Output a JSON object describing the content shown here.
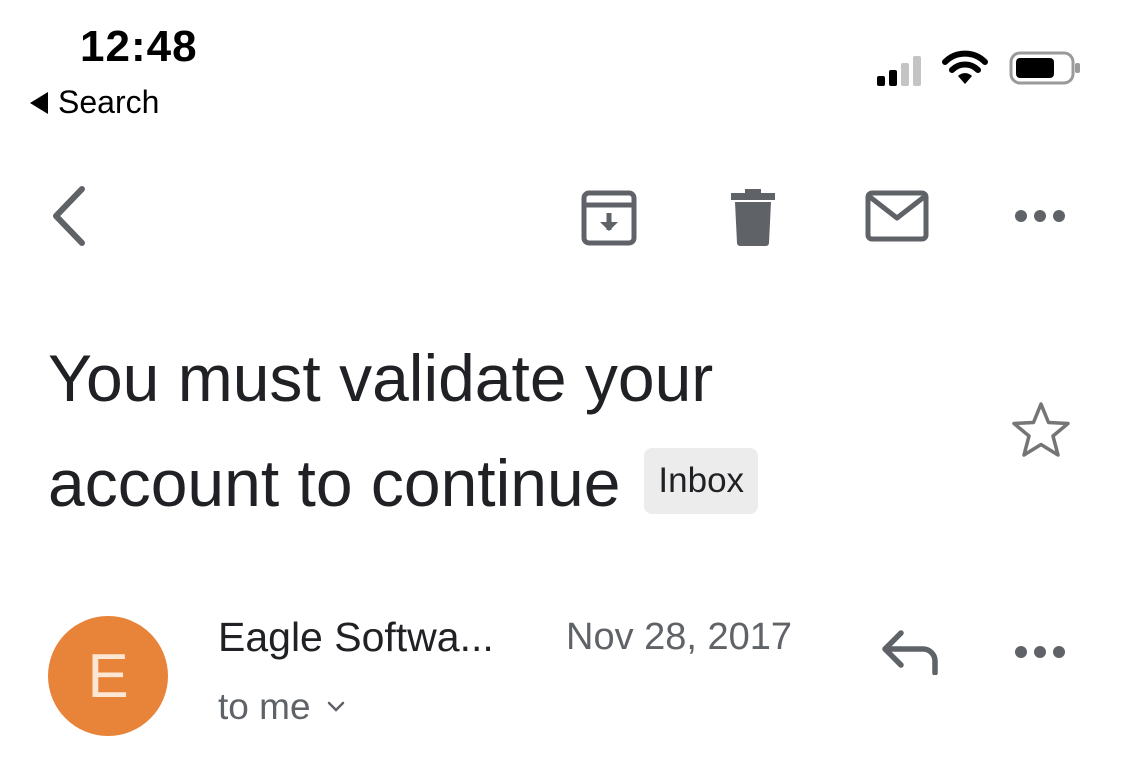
{
  "status_bar": {
    "time": "12:48",
    "back_app_label": "Search",
    "icons": [
      "cellular-signal-icon",
      "wifi-icon",
      "battery-icon"
    ]
  },
  "toolbar": {
    "icons": [
      "back-arrow-icon",
      "archive-icon",
      "trash-icon",
      "mark-unread-icon",
      "more-icon"
    ]
  },
  "email": {
    "subject_line1": "You must validate your",
    "subject_line2": "account to continue",
    "label": "Inbox",
    "sender": "Eagle Softwa...",
    "avatar_letter": "E",
    "date": "Nov 28, 2017",
    "recipient": "to me"
  },
  "colors": {
    "avatar": "#e8843a",
    "icon": "#5f6368",
    "label_chip": "#ececec"
  }
}
